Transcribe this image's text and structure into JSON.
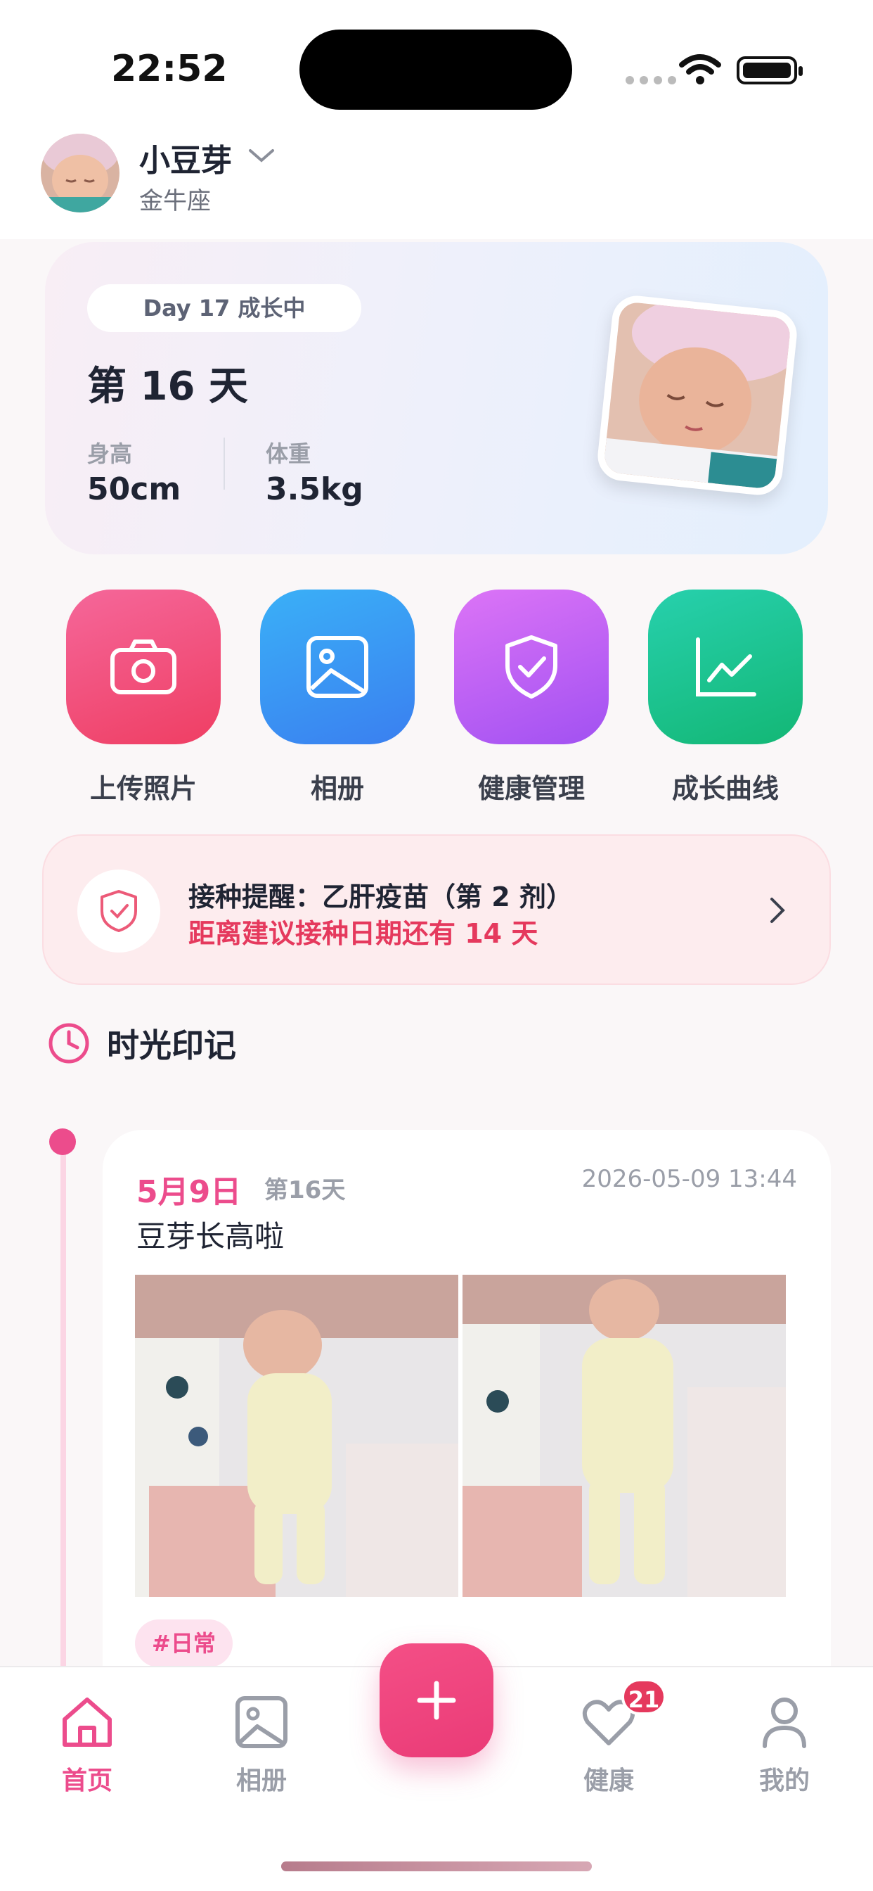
{
  "status_bar": {
    "time": "22:52"
  },
  "header": {
    "baby_name": "小豆芽",
    "zodiac": "金牛座"
  },
  "hero": {
    "pill": "Day 17 成长中",
    "day_title": "第 16 天",
    "height_label": "身高",
    "height_value": "50cm",
    "weight_label": "体重",
    "weight_value": "3.5kg"
  },
  "actions": [
    {
      "label": "上传照片",
      "icon": "camera-icon",
      "color": "#f0567e"
    },
    {
      "label": "相册",
      "icon": "image-icon",
      "color": "#3b91f3"
    },
    {
      "label": "健康管理",
      "icon": "shield-check-icon",
      "color": "#b25cf4"
    },
    {
      "label": "成长曲线",
      "icon": "chart-line-icon",
      "color": "#1fc290"
    }
  ],
  "reminder": {
    "title": "接种提醒：乙肝疫苗（第 2 剂）",
    "subtitle": "距离建议接种日期还有 14 天"
  },
  "section": {
    "title": "时光印记"
  },
  "timeline": [
    {
      "date": "5月9日",
      "day": "第16天",
      "timestamp": "2026-05-09 13:44",
      "title": "豆芽长高啦",
      "tag": "#日常"
    }
  ],
  "tabbar": {
    "items": [
      {
        "label": "首页",
        "icon": "home-icon",
        "active": true
      },
      {
        "label": "相册",
        "icon": "image-icon",
        "active": false
      },
      {
        "label": "健康",
        "icon": "heart-icon",
        "active": false,
        "badge": "21"
      },
      {
        "label": "我的",
        "icon": "user-icon",
        "active": false
      }
    ],
    "add_icon": "plus-icon"
  },
  "colors": {
    "accent": "#ec4c8c",
    "alert": "#e5395d",
    "text": "#1f2433"
  }
}
